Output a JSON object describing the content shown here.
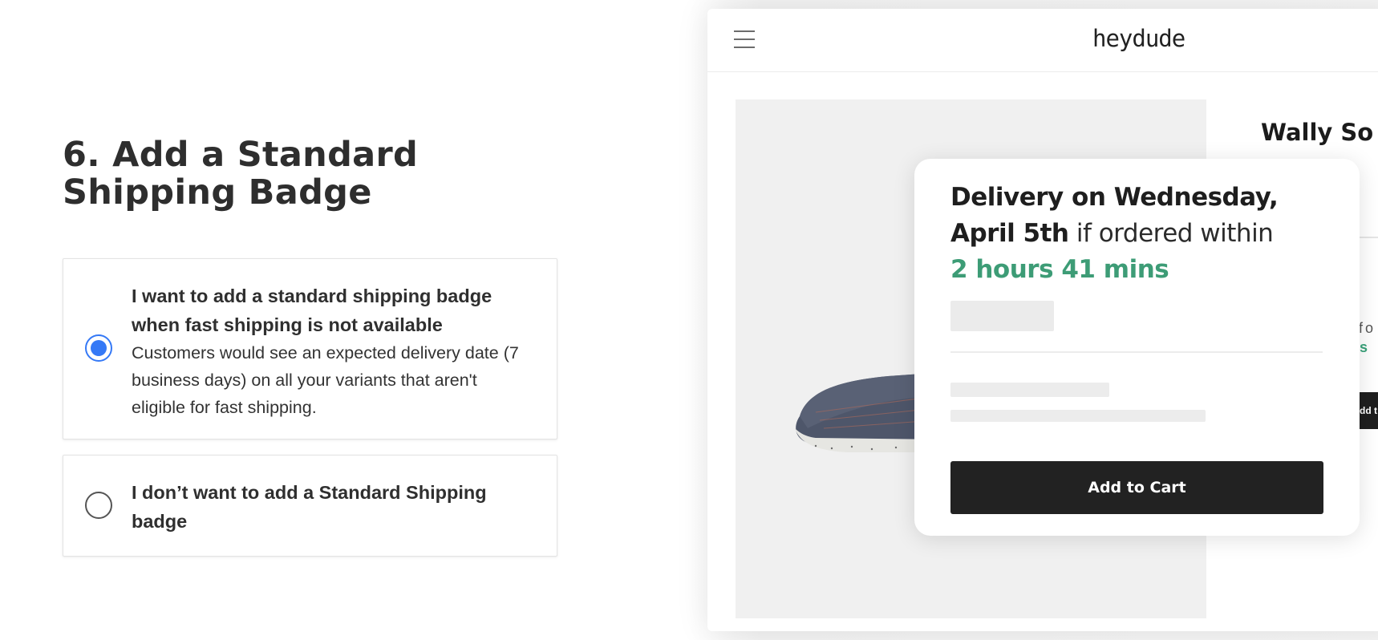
{
  "heading": "6. Add a Standard Shipping Badge",
  "options": [
    {
      "selected": true,
      "title": "I want to add a standard shipping badge when fast shipping is not available",
      "description": "Customers would see an expected delivery date (7 business days) on all your variants that aren't eligible for fast shipping."
    },
    {
      "selected": false,
      "title": "I don’t want to add a Standard Shipping badge",
      "description": ""
    }
  ],
  "preview": {
    "logo": "heydude",
    "product_name": "Wally So",
    "side_text_1": "fo",
    "side_text_2": "s",
    "side_button": "dd t",
    "card": {
      "delivery_bold": "Delivery on Wednesday, April 5th",
      "delivery_rest": " if ordered within",
      "countdown": "2 hours 41 mins",
      "add_to_cart": "Add to Cart"
    }
  },
  "colors": {
    "accent_radio": "#3579f6",
    "countdown_green": "#3d9c76",
    "button_dark": "#222222"
  }
}
